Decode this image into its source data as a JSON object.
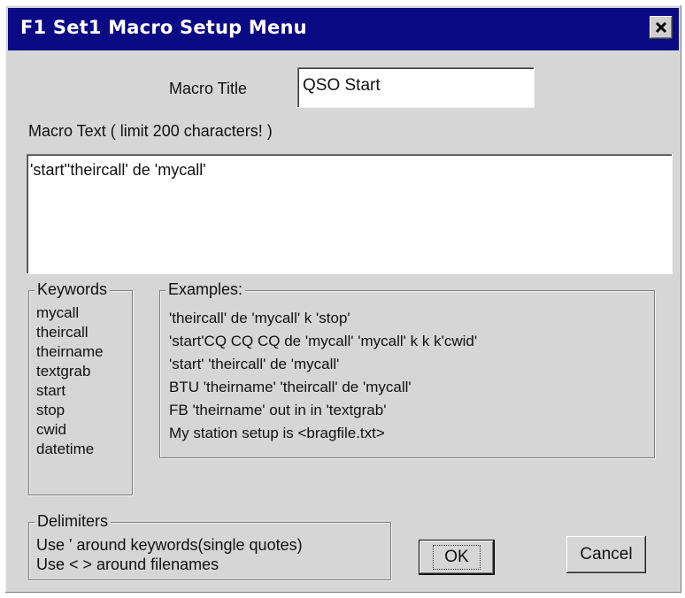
{
  "window": {
    "title": "F1 Set1   Macro Setup Menu",
    "close_icon": "close-icon"
  },
  "macro_title": {
    "label": "Macro Title",
    "value": "QSO Start"
  },
  "macro_text": {
    "label": "Macro Text ( limit 200 characters! )",
    "value": "'start''theircall' de 'mycall'"
  },
  "keywords": {
    "title": "Keywords",
    "items": [
      "mycall",
      "theircall",
      "theirname",
      "textgrab",
      "start",
      "stop",
      "cwid",
      "datetime"
    ]
  },
  "examples": {
    "title": "Examples:",
    "items": [
      "'theircall' de 'mycall' k 'stop'",
      "'start'CQ CQ CQ de 'mycall' 'mycall' k k k'cwid'",
      "'start' 'theircall' de 'mycall'",
      "BTU 'theirname' 'theircall' de 'mycall'",
      "FB 'theirname' out in in 'textgrab'",
      "My station  setup is <bragfile.txt>"
    ]
  },
  "delimiters": {
    "title": "Delimiters",
    "lines": [
      "Use '  around keywords(single quotes)",
      "Use < > around filenames"
    ]
  },
  "buttons": {
    "ok": "OK",
    "cancel": "Cancel"
  }
}
